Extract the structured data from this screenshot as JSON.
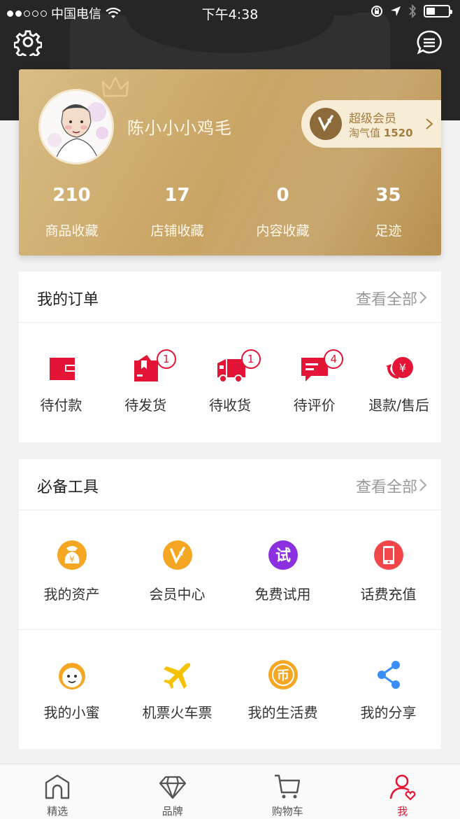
{
  "status_bar": {
    "carrier": "中国电信",
    "time": "下午4:38"
  },
  "profile": {
    "username": "陈小小小鸡毛",
    "vip_title": "超级会员",
    "vip_value_label": "淘气值",
    "vip_value": "1520",
    "stats": [
      {
        "value": "210",
        "label": "商品收藏"
      },
      {
        "value": "17",
        "label": "店铺收藏"
      },
      {
        "value": "0",
        "label": "内容收藏"
      },
      {
        "value": "35",
        "label": "足迹"
      }
    ]
  },
  "orders": {
    "title": "我的订单",
    "more": "查看全部",
    "items": [
      {
        "label": "待付款",
        "badge": "",
        "icon": "wallet-icon"
      },
      {
        "label": "待发货",
        "badge": "1",
        "icon": "package-icon"
      },
      {
        "label": "待收货",
        "badge": "1",
        "icon": "truck-icon"
      },
      {
        "label": "待评价",
        "badge": "4",
        "icon": "comment-icon"
      },
      {
        "label": "退款/售后",
        "badge": "",
        "icon": "refund-icon"
      }
    ]
  },
  "tools": {
    "title": "必备工具",
    "more": "查看全部",
    "items": [
      {
        "label": "我的资产",
        "icon": "money-bag-icon",
        "color": "#f5a623"
      },
      {
        "label": "会员中心",
        "icon": "vip-v-icon",
        "color": "#f5a623"
      },
      {
        "label": "免费试用",
        "icon": "trial-icon",
        "color": "#8b2fe0",
        "glyph": "试"
      },
      {
        "label": "话费充值",
        "icon": "phone-icon",
        "color": "#f0464a"
      },
      {
        "label": "我的小蜜",
        "icon": "bee-icon",
        "color": "#f5a623"
      },
      {
        "label": "机票火车票",
        "icon": "plane-icon",
        "color": "#f5c200"
      },
      {
        "label": "我的生活费",
        "icon": "coin-icon",
        "color": "#f5a623",
        "glyph": "币"
      },
      {
        "label": "我的分享",
        "icon": "share-icon",
        "color": "#3a8ef6"
      }
    ]
  },
  "tabbar": [
    {
      "label": "精选",
      "icon": "home-icon"
    },
    {
      "label": "品牌",
      "icon": "diamond-icon"
    },
    {
      "label": "购物车",
      "icon": "cart-icon"
    },
    {
      "label": "我",
      "icon": "user-icon",
      "active": true
    }
  ],
  "colors": {
    "accent": "#e31436",
    "gold": "#c9a566",
    "dark": "#262626"
  }
}
